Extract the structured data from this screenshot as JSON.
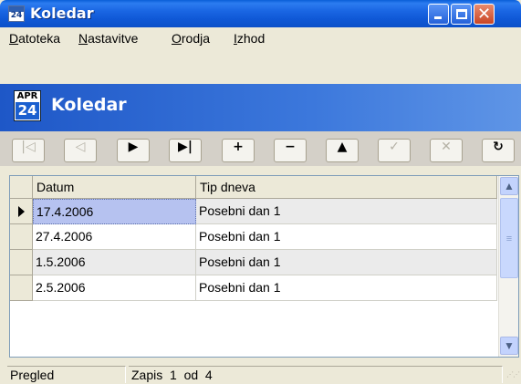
{
  "window": {
    "title": "Koledar",
    "icon_label": "24",
    "controls": {
      "minimize": "minimize-icon",
      "maximize": "maximize-icon",
      "close": "close-icon"
    },
    "close_glyph": "✕"
  },
  "menu": {
    "items": [
      {
        "label": "Datoteka",
        "underline": "D"
      },
      {
        "label": "Nastavitve",
        "underline": "N"
      },
      {
        "label": "Orodja",
        "underline": "O"
      },
      {
        "label": "Izhod",
        "underline": "I"
      }
    ]
  },
  "banner": {
    "icon_month": "APR",
    "icon_day": "24",
    "title": "Koledar"
  },
  "navigator": {
    "buttons": [
      {
        "name": "first-record",
        "glyph": "|◁",
        "enabled": false
      },
      {
        "name": "prior-record",
        "glyph": "◁",
        "enabled": false
      },
      {
        "name": "next-record",
        "glyph": "▶",
        "enabled": true
      },
      {
        "name": "last-record",
        "glyph": "▶|",
        "enabled": true
      },
      {
        "name": "insert-record",
        "glyph": "+",
        "enabled": true
      },
      {
        "name": "delete-record",
        "glyph": "−",
        "enabled": true
      },
      {
        "name": "edit-record",
        "glyph": "▲",
        "enabled": true
      },
      {
        "name": "post-edit",
        "glyph": "✓",
        "enabled": false
      },
      {
        "name": "cancel-edit",
        "glyph": "✕",
        "enabled": false
      },
      {
        "name": "refresh-data",
        "glyph": "↻",
        "enabled": true
      }
    ]
  },
  "grid": {
    "columns": [
      "Datum",
      "Tip dneva"
    ],
    "rows": [
      {
        "datum": "17.4.2006",
        "tip": "Posebni dan 1"
      },
      {
        "datum": "27.4.2006",
        "tip": "Posebni dan 1"
      },
      {
        "datum": "1.5.2006",
        "tip": "Posebni dan 1"
      },
      {
        "datum": "2.5.2006",
        "tip": "Posebni dan 1"
      }
    ],
    "current_row": 0
  },
  "status": {
    "mode": "Pregled",
    "record": "Zapis  1  od  4"
  },
  "colors": {
    "title_bar": "#0f58d6",
    "banner": "#3c78dc",
    "selection": "#b6c2f0",
    "face": "#ece9d8"
  }
}
